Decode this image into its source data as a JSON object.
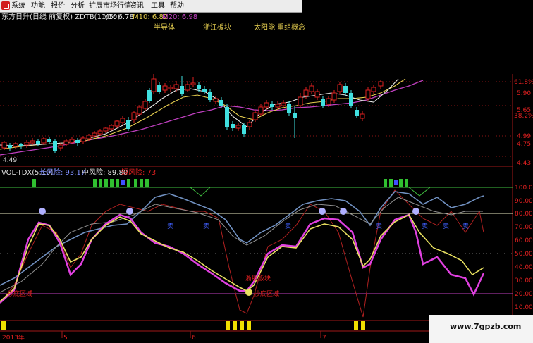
{
  "menu": {
    "items": [
      "系统",
      "功能",
      "报价",
      "分析",
      "扩展市场行情",
      "资讯",
      "工具",
      "帮助"
    ]
  },
  "main_header": {
    "title": "东方日升(日线 前复权) ZDTB(11,10)",
    "m5": "M5: 6.78",
    "m10": "M10: 6.82",
    "m20": "M20: 6.98"
  },
  "annotations": [
    "半导体",
    "浙江板块",
    "太阳能 重组概念"
  ],
  "price_axis": {
    "ticks": [
      "61.8%",
      "5.90",
      "5.65",
      "38.2%",
      "4.99",
      "4.75",
      "4.43"
    ],
    "low_label": "4.49"
  },
  "indicator_header": {
    "title": "VOL-TDX(5,10)",
    "long": "长风险: 93.17",
    "mid": "中风险: 89.80",
    "short": "短风险: 73"
  },
  "indicator_axis": {
    "ticks": [
      "100.00",
      "90.00",
      "80.00",
      "70.00",
      "60.00",
      "50.00",
      "40.00",
      "30.00",
      "20.00",
      "10.00"
    ]
  },
  "chart_labels": {
    "buy_zone": "抄底区域",
    "stock_label": "浙股板块",
    "lows_zone": "抄底区域",
    "sell_marks": [
      "卖",
      "卖",
      "卖",
      "卖",
      "卖",
      "卖",
      "卖"
    ]
  },
  "time_axis": {
    "labels": [
      "2013年",
      "5",
      "6",
      "7"
    ]
  },
  "watermark": "www.7gpzb.com",
  "colors": {
    "background": "#000000",
    "up": "#e02020",
    "down": "#40e0e0",
    "ma_white": "#e8e8e8",
    "ma_yellow": "#e8d050",
    "ma_purple": "#c040c0",
    "green_line": "#40c040",
    "pink_line": "#e040e0",
    "blue_line": "#7090c0"
  }
}
